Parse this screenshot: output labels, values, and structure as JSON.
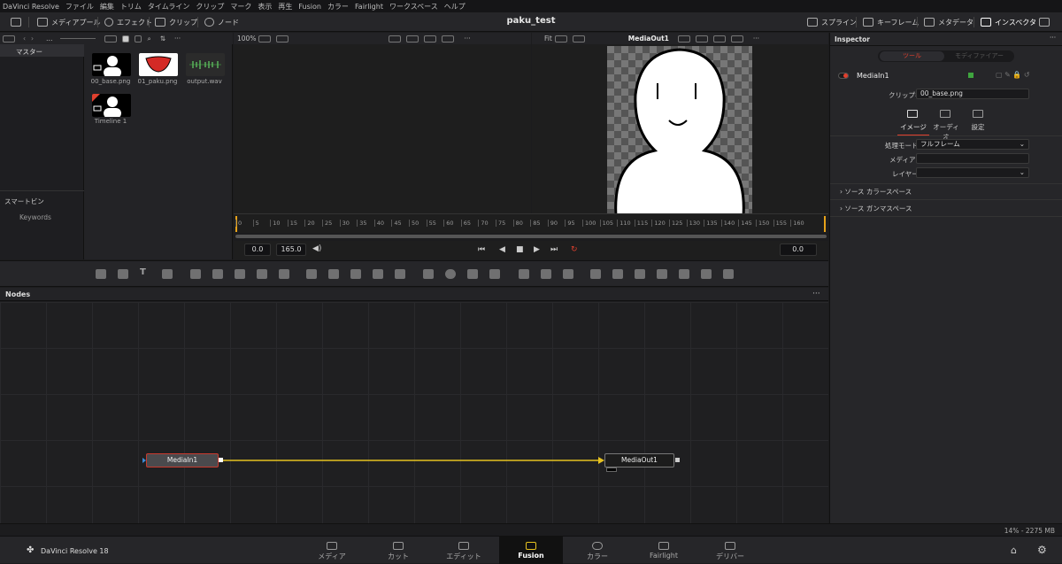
{
  "menu": [
    "DaVinci Resolve",
    "ファイル",
    "編集",
    "トリム",
    "タイムライン",
    "クリップ",
    "マーク",
    "表示",
    "再生",
    "Fusion",
    "カラー",
    "Fairlight",
    "ワークスペース",
    "ヘルプ"
  ],
  "toolbar": {
    "media_pool": "メディアプール",
    "effects": "エフェクト",
    "clips": "クリップ",
    "nodes": "ノード",
    "project_title": "paku_test",
    "spline": "スプライン",
    "keyframes": "キーフレーム",
    "metadata": "メタデータ",
    "inspector": "インスペクタ"
  },
  "viewer_bar": {
    "zoom_left": "100%",
    "zoom_right": "Fit",
    "viewer_name": "MediaOut1"
  },
  "media_pool": {
    "master": "マスター",
    "smart_bins": "スマートビン",
    "keywords": "Keywords",
    "clips": [
      {
        "name": "00_base.png"
      },
      {
        "name": "01_paku.png"
      },
      {
        "name": "output.wav"
      },
      {
        "name": "Timeline 1"
      }
    ]
  },
  "ruler": {
    "ticks": [
      "0",
      "5",
      "10",
      "15",
      "20",
      "25",
      "30",
      "35",
      "40",
      "45",
      "50",
      "55",
      "60",
      "65",
      "70",
      "75",
      "80",
      "85",
      "90",
      "95",
      "100",
      "105",
      "110",
      "115",
      "120",
      "125",
      "130",
      "135",
      "140",
      "145",
      "150",
      "155",
      "160"
    ]
  },
  "transport": {
    "start": "0.0",
    "end": "165.0",
    "timecode": "0.0"
  },
  "nodes_panel": {
    "title": "Nodes",
    "media_in": "MediaIn1",
    "media_out": "MediaOut1"
  },
  "inspector": {
    "title": "Inspector",
    "tab_tools": "ツール",
    "tab_modifiers": "モディファイアー",
    "node_name": "MediaIn1",
    "clip_name_label": "クリップ名",
    "clip_name_value": "00_base.png",
    "subtab_image": "イメージ",
    "subtab_audio": "オーディオ",
    "subtab_settings": "設定",
    "process_mode_label": "処理モード",
    "process_mode_value": "フルフレーム",
    "media_id_label": "メディアID",
    "media_id_value": "",
    "layer_label": "レイヤー",
    "layer_value": "",
    "source_colorspace": "ソース カラースペース",
    "source_gamma": "ソース ガンマスペース"
  },
  "status": {
    "memory": "14% - 2275 MB"
  },
  "pages": {
    "app_name": "DaVinci Resolve 18",
    "items": [
      "メディア",
      "カット",
      "エディット",
      "Fusion",
      "カラー",
      "Fairlight",
      "デリバー"
    ],
    "active": "Fusion"
  },
  "colors": {
    "accent_red": "#e0402e",
    "link_yellow": "#e6c220",
    "node_select": "#c93a2e"
  }
}
